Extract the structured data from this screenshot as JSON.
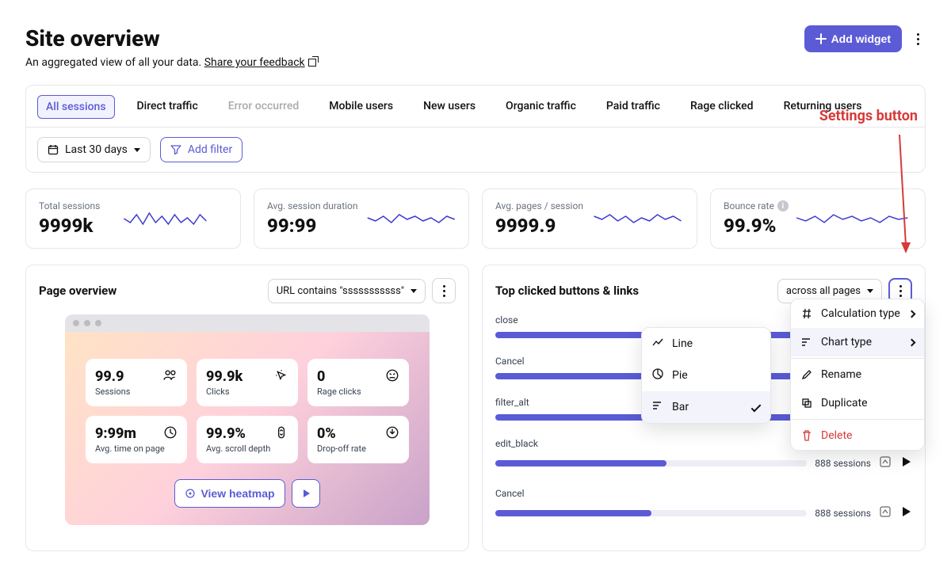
{
  "annotation": {
    "label": "Settings button"
  },
  "header": {
    "title": "Site overview",
    "subtitle_prefix": "An aggregated view of all your data. ",
    "feedback_link": "Share your feedback",
    "add_widget": "Add widget"
  },
  "tabs": [
    {
      "label": "All sessions",
      "active": true,
      "disabled": false
    },
    {
      "label": "Direct traffic",
      "active": false,
      "disabled": false
    },
    {
      "label": "Error occurred",
      "active": false,
      "disabled": true
    },
    {
      "label": "Mobile users",
      "active": false,
      "disabled": false
    },
    {
      "label": "New users",
      "active": false,
      "disabled": false
    },
    {
      "label": "Organic traffic",
      "active": false,
      "disabled": false
    },
    {
      "label": "Paid traffic",
      "active": false,
      "disabled": false
    },
    {
      "label": "Rage clicked",
      "active": false,
      "disabled": false
    },
    {
      "label": "Returning users",
      "active": false,
      "disabled": false
    }
  ],
  "filters": {
    "date_range": "Last 30 days",
    "add_filter": "Add filter"
  },
  "metrics": [
    {
      "label": "Total sessions",
      "value": "9999k",
      "info": false
    },
    {
      "label": "Avg. session duration",
      "value": "99:99",
      "info": false
    },
    {
      "label": "Avg. pages / session",
      "value": "9999.9",
      "info": false
    },
    {
      "label": "Bounce rate",
      "value": "99.9%",
      "info": true
    }
  ],
  "page_overview": {
    "title": "Page overview",
    "filter_select": "URL contains \"sssssssssss\"",
    "mini": [
      {
        "value": "99.9",
        "label": "Sessions",
        "icon": "users-icon"
      },
      {
        "value": "99.9k",
        "label": "Clicks",
        "icon": "cursor-click-icon"
      },
      {
        "value": "0",
        "label": "Rage clicks",
        "icon": "angry-face-icon"
      },
      {
        "value": "9:99m",
        "label": "Avg. time on page",
        "icon": "clock-icon"
      },
      {
        "value": "99.9%",
        "label": "Avg. scroll depth",
        "icon": "scroll-icon"
      },
      {
        "value": "0%",
        "label": "Drop-off rate",
        "icon": "download-icon"
      }
    ],
    "view_heatmap": "View heatmap"
  },
  "top_clicked": {
    "title": "Top clicked buttons & links",
    "scope_select": "across all pages",
    "bars_meta": "888 sessions",
    "items": [
      {
        "label": "close",
        "pct": 100,
        "show_meta": false
      },
      {
        "label": "Cancel",
        "pct": 88,
        "show_meta": false
      },
      {
        "label": "filter_alt",
        "pct": 78,
        "show_meta": false
      },
      {
        "label": "edit_black",
        "pct": 55,
        "show_meta": true
      },
      {
        "label": "Cancel",
        "pct": 50,
        "show_meta": true
      }
    ]
  },
  "chart_data": {
    "type": "bar",
    "orientation": "horizontal",
    "title": "Top clicked buttons & links",
    "categories": [
      "close",
      "Cancel",
      "filter_alt",
      "edit_black",
      "Cancel"
    ],
    "values": [
      100,
      88,
      78,
      55,
      50
    ],
    "unit": "relative width (%)",
    "note": "Bars represent relative click count; sessions label shown: 888 sessions"
  },
  "chart_type_menu": {
    "items": [
      {
        "label": "Line",
        "icon": "line-chart-icon",
        "selected": false
      },
      {
        "label": "Pie",
        "icon": "pie-chart-icon",
        "selected": false
      },
      {
        "label": "Bar",
        "icon": "bar-chart-icon",
        "selected": true
      }
    ]
  },
  "settings_menu": {
    "calculation_type": "Calculation type",
    "chart_type": "Chart type",
    "rename": "Rename",
    "duplicate": "Duplicate",
    "delete": "Delete"
  }
}
